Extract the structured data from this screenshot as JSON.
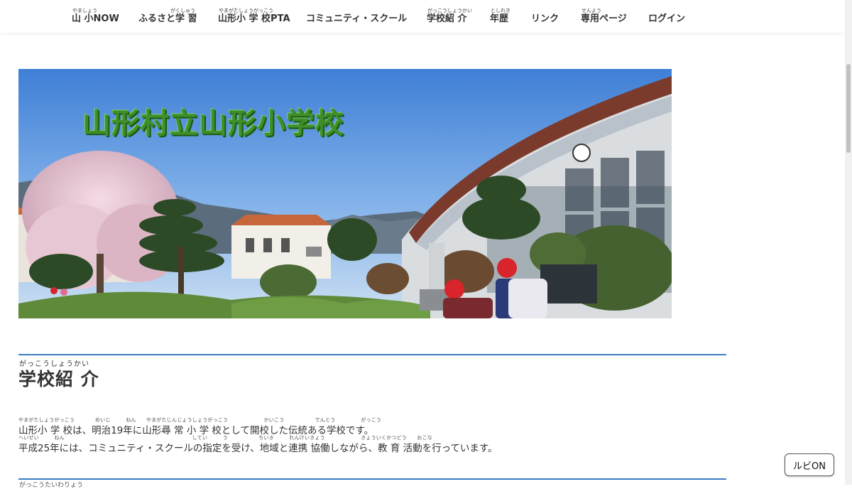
{
  "nav": {
    "items": [
      {
        "ruby": "やましょう",
        "label": "山 小NOW"
      },
      {
        "ruby": "がくしゅう",
        "label": "ふるさと学 習"
      },
      {
        "ruby": "やまがたしょうがっこう",
        "label": "山形小 学 校PTA"
      },
      {
        "ruby": "",
        "label": "コミュニティ・スクール"
      },
      {
        "ruby": "がっこうしょうかい",
        "label": "学校紹 介"
      },
      {
        "ruby": "としれき",
        "label": "年歴"
      },
      {
        "ruby": "",
        "label": "リンク"
      },
      {
        "ruby": "せんよう",
        "label": "専用ページ"
      },
      {
        "ruby": "",
        "label": "ログイン"
      }
    ]
  },
  "banner": {
    "title": "山形村立山形小学校"
  },
  "section": {
    "ruby": "がっこうしょうかい",
    "title": "学校紹 介",
    "para1_ruby": "やまがたしょうがっこう　　　　めいじ　　　ねん　　やまがたじんじょうしょうがっこう　　　　　　　かいこう　　　　　　でんとう　　　　　がっこう",
    "para1": "山形小 学 校は、明治19年に山形尋 常 小 学 校として開校した伝統ある学校です。",
    "para2_ruby": "へいせい　　　ねん　　　　　　　　　　　　　　　　　　　　　　　　　してい　　　う　　　　　　ちいき　　　れんけいきょう　　　　　　　きょういくかつどう　　おこな",
    "para2": "平成25年には、コミュニティ・スクールの指定を受け、地域と連携 協働しながら、教 育 活動を行っています。"
  },
  "next_section_ruby": "がっこうたいわりょう",
  "ruby_toggle": {
    "label": "ルビON"
  },
  "colors": {
    "accent_rule": "#3d7cc4",
    "title_green": "#3f8f2a"
  }
}
